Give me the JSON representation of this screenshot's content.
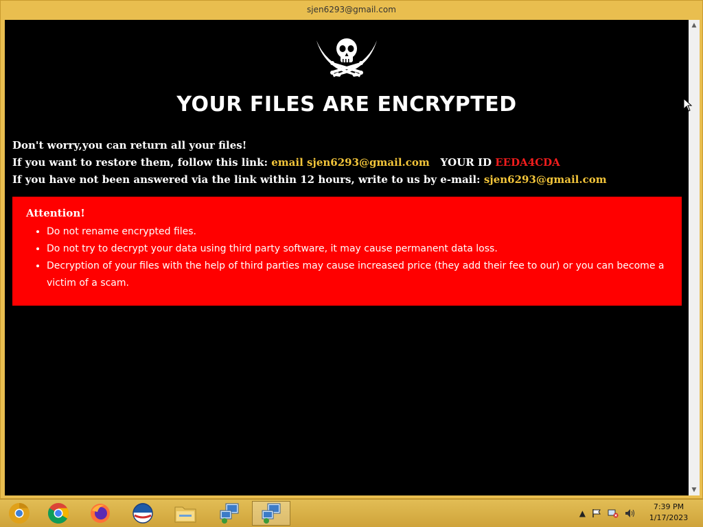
{
  "window": {
    "title": "sjen6293@gmail.com"
  },
  "note": {
    "headline": "YOUR FILES ARE ENCRYPTED",
    "line1": "Don't worry,you can return all your files!",
    "line2_prefix": "If you want to restore them, follow this link: ",
    "line2_link": "email sjen6293@gmail.com",
    "line2_id_label": "YOUR ID",
    "line2_id": "EEDA4CDA",
    "line3_prefix": "If you have not been answered via the link within 12 hours, write to us by e-mail: ",
    "line3_email": "sjen6293@gmail.com",
    "attention_title": "Attention!",
    "bullets": [
      "Do not rename encrypted files.",
      "Do not try to decrypt your data using third party software, it may cause permanent data loss.",
      "Decryption of your files with the help of third parties may cause increased price (they add their fee to our) or you can become a victim of a scam."
    ]
  },
  "colors": {
    "background": "#000000",
    "highlight_email": "#f3c53a",
    "highlight_id": "#f21d1d",
    "attention_box": "#ff0000",
    "taskbar": "#d8b34a"
  },
  "taskbar": {
    "items": [
      "chrome-canary-icon",
      "chrome-icon",
      "firefox-icon",
      "opera-icon",
      "file-explorer-icon",
      "remote-desktop-icon",
      "remote-desktop-icon"
    ],
    "active_item": 6,
    "tray_icons": [
      "show-hidden-icons-chevron",
      "action-center-flag-icon",
      "network-error-icon",
      "speaker-icon"
    ],
    "time": "7:39 PM",
    "date": "1/17/2023"
  }
}
